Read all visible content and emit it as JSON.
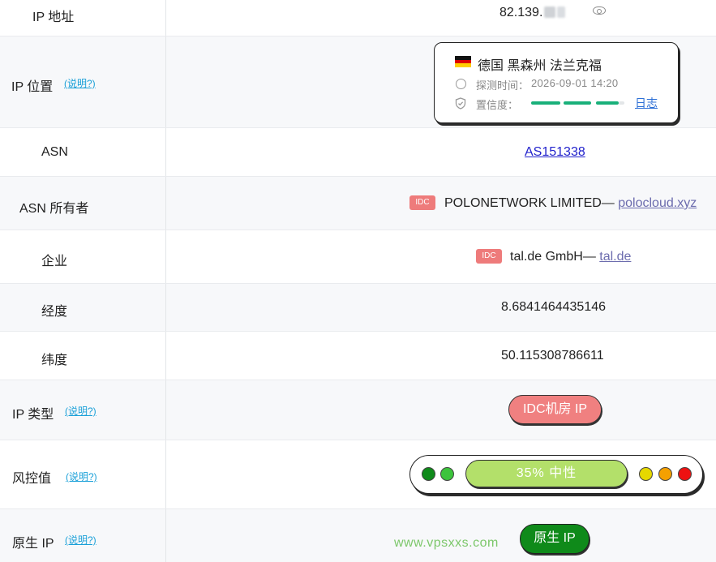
{
  "rows": {
    "ip_address": {
      "label": "IP 地址",
      "value": "82.139."
    },
    "ip_location": {
      "label": "IP 位置",
      "explain": "(说明?)",
      "flag": "germany-flag",
      "location": "德国 黑森州 法兰克福",
      "detect_time_label": "探测时间：",
      "detect_time_value": "2026-09-01 14:20",
      "confidence_label": "置信度：",
      "confidence_level": 0.9,
      "log_link": "日志"
    },
    "asn": {
      "label": "ASN",
      "value": "AS151338"
    },
    "asn_owner": {
      "label": "ASN 所有者",
      "tag": "IDC",
      "name": "POLONETWORK LIMITED—",
      "domain": "polocloud.xyz"
    },
    "company": {
      "label": "企业",
      "tag": "IDC",
      "name": "tal.de GmbH—",
      "domain": "tal.de"
    },
    "longitude": {
      "label": "经度",
      "value": "8.6841464435146"
    },
    "latitude": {
      "label": "纬度",
      "value": "50.115308786611"
    },
    "ip_type": {
      "label": "IP 类型",
      "explain": "(说明?)",
      "value": "IDC机房 IP"
    },
    "risk": {
      "label": "风控值",
      "explain": "(说明?)",
      "value_text": "35%  中性",
      "percent": 35,
      "dot_colors": [
        "#0f8a1a",
        "#3cc43c",
        "#e6d800",
        "#f5a000",
        "#ee1111"
      ]
    },
    "native_ip": {
      "label": "原生 IP",
      "explain": "(说明?)",
      "value": "原生 IP"
    }
  },
  "watermark": "www.vpsxxs.com",
  "colors": {
    "idc_tag": "#ee7b7b",
    "type_pill": "#f08080",
    "risk_pill": "#b3e06a",
    "native_pill": "#0f8a1a",
    "confidence": "#19b07a",
    "explain_link": "#1aa0d8"
  }
}
